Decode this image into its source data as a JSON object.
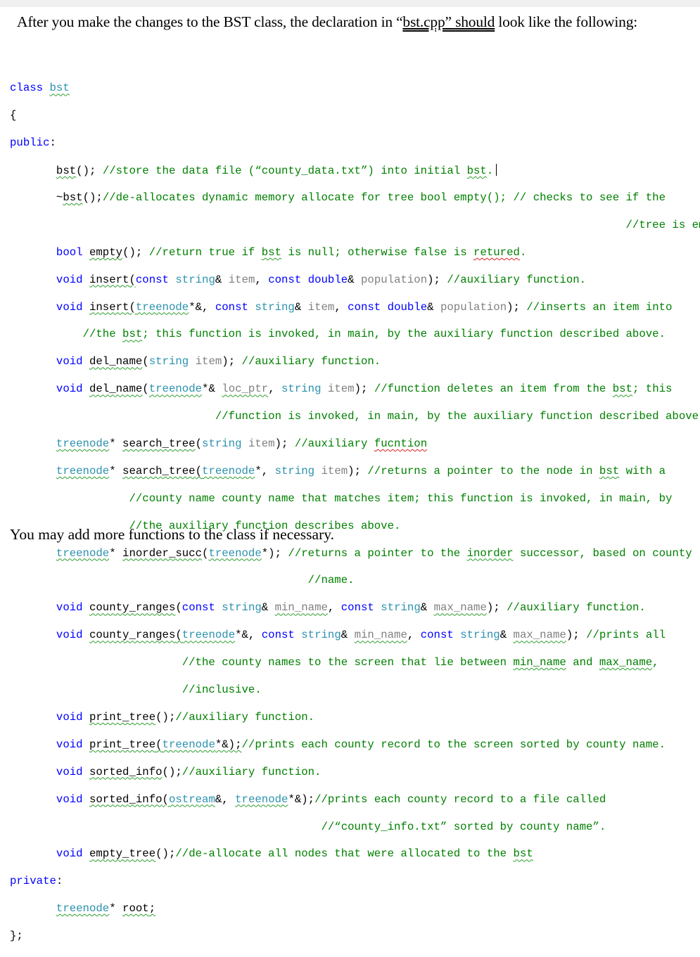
{
  "intro": {
    "part1": "After you make the changes to  the BST class, the declaration in “",
    "filename": "bst.cpp",
    "part2": "”  ",
    "should": "should",
    "part3": " look like the following:"
  },
  "code": {
    "l01": {
      "a": "class",
      "b": " ",
      "c": "bst"
    },
    "l02": {
      "a": "{"
    },
    "l03": {
      "a": "public",
      "b": ":"
    },
    "l04": {
      "a": "       ",
      "b": "bst",
      "c": "(); ",
      "d": "//store the data file (“county_data.txt”) into initial ",
      "e": "bst",
      "f": "."
    },
    "l05": {
      "a": "       ~",
      "b": "bst",
      "c": "();",
      "d": "//de-allocates dynamic memory allocate for tree bool empty(); // checks to see if the"
    },
    "l06": {
      "a": "                                                                                             //tree is empty."
    },
    "l07": {
      "a": "       ",
      "b": "bool",
      "c": " ",
      "d": "empty",
      "e": "(); ",
      "f": "//return true if ",
      "g": "bst",
      "h": " is null; otherwise false is ",
      "i": "retured",
      "j": "."
    },
    "l08": {
      "a": "       ",
      "b": "void",
      "c": " ",
      "d": "insert",
      "e": "(",
      "f": "const",
      "g": " ",
      "h": "string",
      "i": "& ",
      "j": "item",
      "k": ", ",
      "l": "const",
      "m": " ",
      "n": "double",
      "o": "& ",
      "p": "population",
      "q": "); ",
      "r": "//auxiliary function."
    },
    "l09": {
      "a": "       ",
      "b": "void",
      "c": " ",
      "d": "insert",
      "e": "(",
      "f": "treenode",
      "g": "*&, ",
      "h": "const",
      "i": " ",
      "j": "string",
      "k": "& ",
      "l": "item",
      "m": ", ",
      "n": "const",
      "o": " ",
      "p": "double",
      "q": "& ",
      "r": "population",
      "s": "); ",
      "t": "//inserts an item into"
    },
    "l10": {
      "a": "           ",
      "b": "//the ",
      "c": "bst",
      "d": "; this function is invoked, in main, by the auxiliary function described above."
    },
    "l11": {
      "a": "       ",
      "b": "void",
      "c": " ",
      "d": "del_name",
      "e": "(",
      "f": "string",
      "g": " ",
      "h": "item",
      "i": "); ",
      "j": "//auxiliary function."
    },
    "l12": {
      "a": "       ",
      "b": "void",
      "c": " ",
      "d": "del_name",
      "e": "(",
      "f": "treenode",
      "g": "*& ",
      "h": "loc_ptr",
      "i": ", ",
      "j": "string",
      "k": " ",
      "l": "item",
      "m": "); ",
      "n": "//function deletes an item from the ",
      "o": "bst",
      "p": "; this"
    },
    "l13": {
      "a": "                               ",
      "b": "//function is invoked, in main, by the auxiliary function described above."
    },
    "l14": {
      "a": "       ",
      "b": "treenode",
      "c": "* ",
      "d": "search_tree",
      "e": "(",
      "f": "string",
      "g": " ",
      "h": "item",
      "i": "); ",
      "j": "//auxiliary ",
      "k": "fucntion"
    },
    "l15": {
      "a": "       ",
      "b": "treenode",
      "c": "* ",
      "d": "search_tree",
      "e": "(",
      "f": "treenode",
      "g": "*, ",
      "h": "string",
      "i": " ",
      "j": "item",
      "k": "); ",
      "l": "//returns a pointer to the node in ",
      "m": "bst",
      "n": " with a"
    },
    "l16": {
      "a": "                  ",
      "b": "//county name county name that matches item; this function is invoked, in main, by"
    },
    "l17": {
      "a": "                  ",
      "b": "//the auxiliary function describes above."
    },
    "l18": {
      "a": "       ",
      "b": "treenode",
      "c": "* ",
      "d": "inorder_succ",
      "e": "(",
      "f": "treenode",
      "g": "*); ",
      "h": "//returns a pointer to the ",
      "i": "inorder",
      "j": " successor, based on county"
    },
    "l19": {
      "a": "                                             ",
      "b": "//name."
    },
    "l20": {
      "a": "       ",
      "b": "void",
      "c": " ",
      "d": "county_ranges",
      "e": "(",
      "f": "const",
      "g": " ",
      "h": "string",
      "i": "& ",
      "j": "min_name",
      "k": ", ",
      "l": "const",
      "m": " ",
      "n": "string",
      "o": "& ",
      "p": "max_name",
      "q": "); ",
      "r": "//auxiliary function."
    },
    "l21": {
      "a": "       ",
      "b": "void",
      "c": " ",
      "d": "county_ranges",
      "e": "(",
      "f": "treenode",
      "g": "*&, ",
      "h": "const",
      "i": " ",
      "j": "string",
      "k": "& ",
      "l": "min_name",
      "m": ", ",
      "n": "const",
      "o": " ",
      "p": "string",
      "q": "& ",
      "r": "max_name",
      "s": "); ",
      "t": "//prints all"
    },
    "l22": {
      "a": "                          ",
      "b": "//the county names to the screen that lie between ",
      "c": "min_name",
      "d": " and ",
      "e": "max_name",
      "f": ","
    },
    "l23": {
      "a": "                          ",
      "b": "//inclusive."
    },
    "l24": {
      "a": "       ",
      "b": "void",
      "c": " ",
      "d": "print_tree",
      "e": "();",
      "f": "//auxiliary function."
    },
    "l25": {
      "a": "       ",
      "b": "void",
      "c": " ",
      "d": "print_tree",
      "e": "(",
      "f": "treenode",
      "g": "*&);",
      "h": "//prints each county record to the screen sorted by county name."
    },
    "l26": {
      "a": "       ",
      "b": "void",
      "c": " ",
      "d": "sorted_info",
      "e": "();",
      "f": "//auxiliary function."
    },
    "l27": {
      "a": "       ",
      "b": "void",
      "c": " ",
      "d": "sorted_info",
      "e": "(",
      "f": "ostream",
      "g": "&, ",
      "h": "treenode",
      "i": "*&);",
      "j": "//prints each county record to a file called"
    },
    "l28": {
      "a": "                                               ",
      "b": "//“county_info.txt” sorted by county name”."
    },
    "l29": {
      "a": "       ",
      "b": "void",
      "c": " ",
      "d": "empty_tree",
      "e": "();",
      "f": "//de-allocate all nodes that were allocated to the ",
      "g": "bst"
    },
    "l30": {
      "a": "private",
      "b": ":"
    },
    "l31": {
      "a": "       ",
      "b": "treenode",
      "c": "* ",
      "d": "root",
      "e": ";"
    },
    "l32": {
      "a": "};"
    }
  },
  "outro": "You may add more functions to the class if necessary."
}
